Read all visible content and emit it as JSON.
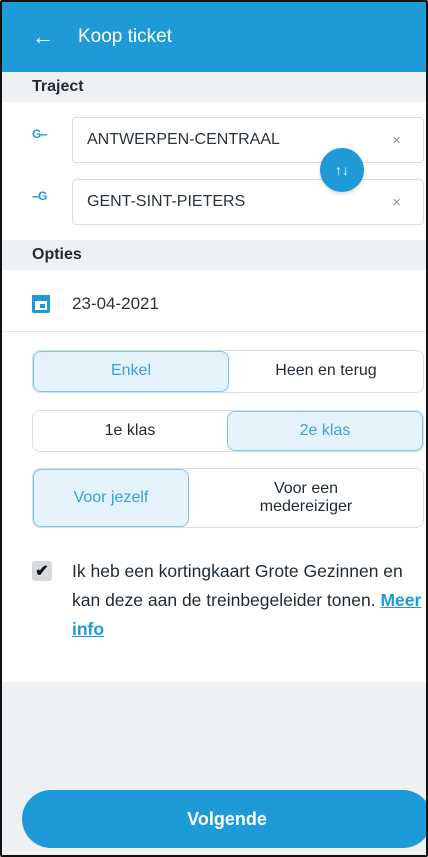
{
  "header": {
    "back_icon": "arrow-left-icon",
    "title": "Koop ticket"
  },
  "traject": {
    "section_label": "Traject",
    "from": {
      "marker": "G--",
      "value": "ANTWERPEN-CENTRAAL",
      "clear": "×"
    },
    "to": {
      "marker": "--G",
      "value": "GENT-SINT-PIETERS",
      "clear": "×"
    },
    "swap_symbol": "↑↓"
  },
  "opties": {
    "section_label": "Opties",
    "date_icon": "calendar-icon",
    "date": "23-04-2021",
    "trip_type": {
      "options": [
        "Enkel",
        "Heen en terug"
      ],
      "selected": "Enkel"
    },
    "class": {
      "options": [
        "1e klas",
        "2e klas"
      ],
      "selected": "2e klas"
    },
    "traveler": {
      "options": [
        "Voor jezelf",
        "Voor een medereiziger"
      ],
      "selected": "Voor jezelf"
    }
  },
  "discount": {
    "checked": true,
    "check_mark": "✔",
    "text": "Ik heb een kortingkaart Grote Gezinnen en kan deze aan de treinbegeleider tonen.",
    "link": "Meer info"
  },
  "footer": {
    "next_label": "Volgende"
  },
  "colors": {
    "primary": "#1f9ad9",
    "selected_bg": "#e4f3fb",
    "section_bg": "#eef1f4"
  }
}
